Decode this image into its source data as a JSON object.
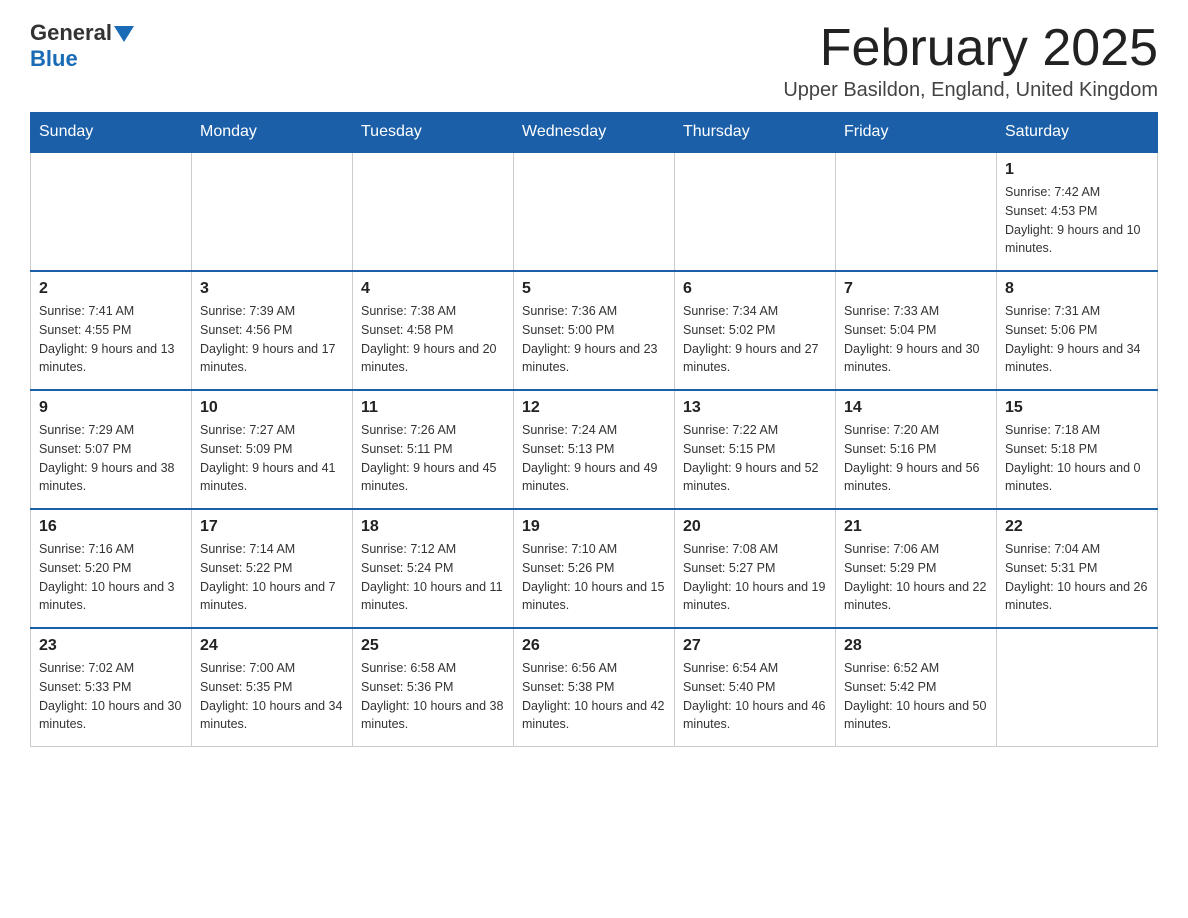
{
  "header": {
    "logo": {
      "general": "General",
      "blue": "Blue"
    },
    "title": "February 2025",
    "location": "Upper Basildon, England, United Kingdom"
  },
  "weekdays": [
    "Sunday",
    "Monday",
    "Tuesday",
    "Wednesday",
    "Thursday",
    "Friday",
    "Saturday"
  ],
  "weeks": [
    [
      {
        "day": "",
        "info": ""
      },
      {
        "day": "",
        "info": ""
      },
      {
        "day": "",
        "info": ""
      },
      {
        "day": "",
        "info": ""
      },
      {
        "day": "",
        "info": ""
      },
      {
        "day": "",
        "info": ""
      },
      {
        "day": "1",
        "info": "Sunrise: 7:42 AM\nSunset: 4:53 PM\nDaylight: 9 hours and 10 minutes."
      }
    ],
    [
      {
        "day": "2",
        "info": "Sunrise: 7:41 AM\nSunset: 4:55 PM\nDaylight: 9 hours and 13 minutes."
      },
      {
        "day": "3",
        "info": "Sunrise: 7:39 AM\nSunset: 4:56 PM\nDaylight: 9 hours and 17 minutes."
      },
      {
        "day": "4",
        "info": "Sunrise: 7:38 AM\nSunset: 4:58 PM\nDaylight: 9 hours and 20 minutes."
      },
      {
        "day": "5",
        "info": "Sunrise: 7:36 AM\nSunset: 5:00 PM\nDaylight: 9 hours and 23 minutes."
      },
      {
        "day": "6",
        "info": "Sunrise: 7:34 AM\nSunset: 5:02 PM\nDaylight: 9 hours and 27 minutes."
      },
      {
        "day": "7",
        "info": "Sunrise: 7:33 AM\nSunset: 5:04 PM\nDaylight: 9 hours and 30 minutes."
      },
      {
        "day": "8",
        "info": "Sunrise: 7:31 AM\nSunset: 5:06 PM\nDaylight: 9 hours and 34 minutes."
      }
    ],
    [
      {
        "day": "9",
        "info": "Sunrise: 7:29 AM\nSunset: 5:07 PM\nDaylight: 9 hours and 38 minutes."
      },
      {
        "day": "10",
        "info": "Sunrise: 7:27 AM\nSunset: 5:09 PM\nDaylight: 9 hours and 41 minutes."
      },
      {
        "day": "11",
        "info": "Sunrise: 7:26 AM\nSunset: 5:11 PM\nDaylight: 9 hours and 45 minutes."
      },
      {
        "day": "12",
        "info": "Sunrise: 7:24 AM\nSunset: 5:13 PM\nDaylight: 9 hours and 49 minutes."
      },
      {
        "day": "13",
        "info": "Sunrise: 7:22 AM\nSunset: 5:15 PM\nDaylight: 9 hours and 52 minutes."
      },
      {
        "day": "14",
        "info": "Sunrise: 7:20 AM\nSunset: 5:16 PM\nDaylight: 9 hours and 56 minutes."
      },
      {
        "day": "15",
        "info": "Sunrise: 7:18 AM\nSunset: 5:18 PM\nDaylight: 10 hours and 0 minutes."
      }
    ],
    [
      {
        "day": "16",
        "info": "Sunrise: 7:16 AM\nSunset: 5:20 PM\nDaylight: 10 hours and 3 minutes."
      },
      {
        "day": "17",
        "info": "Sunrise: 7:14 AM\nSunset: 5:22 PM\nDaylight: 10 hours and 7 minutes."
      },
      {
        "day": "18",
        "info": "Sunrise: 7:12 AM\nSunset: 5:24 PM\nDaylight: 10 hours and 11 minutes."
      },
      {
        "day": "19",
        "info": "Sunrise: 7:10 AM\nSunset: 5:26 PM\nDaylight: 10 hours and 15 minutes."
      },
      {
        "day": "20",
        "info": "Sunrise: 7:08 AM\nSunset: 5:27 PM\nDaylight: 10 hours and 19 minutes."
      },
      {
        "day": "21",
        "info": "Sunrise: 7:06 AM\nSunset: 5:29 PM\nDaylight: 10 hours and 22 minutes."
      },
      {
        "day": "22",
        "info": "Sunrise: 7:04 AM\nSunset: 5:31 PM\nDaylight: 10 hours and 26 minutes."
      }
    ],
    [
      {
        "day": "23",
        "info": "Sunrise: 7:02 AM\nSunset: 5:33 PM\nDaylight: 10 hours and 30 minutes."
      },
      {
        "day": "24",
        "info": "Sunrise: 7:00 AM\nSunset: 5:35 PM\nDaylight: 10 hours and 34 minutes."
      },
      {
        "day": "25",
        "info": "Sunrise: 6:58 AM\nSunset: 5:36 PM\nDaylight: 10 hours and 38 minutes."
      },
      {
        "day": "26",
        "info": "Sunrise: 6:56 AM\nSunset: 5:38 PM\nDaylight: 10 hours and 42 minutes."
      },
      {
        "day": "27",
        "info": "Sunrise: 6:54 AM\nSunset: 5:40 PM\nDaylight: 10 hours and 46 minutes."
      },
      {
        "day": "28",
        "info": "Sunrise: 6:52 AM\nSunset: 5:42 PM\nDaylight: 10 hours and 50 minutes."
      },
      {
        "day": "",
        "info": ""
      }
    ]
  ]
}
